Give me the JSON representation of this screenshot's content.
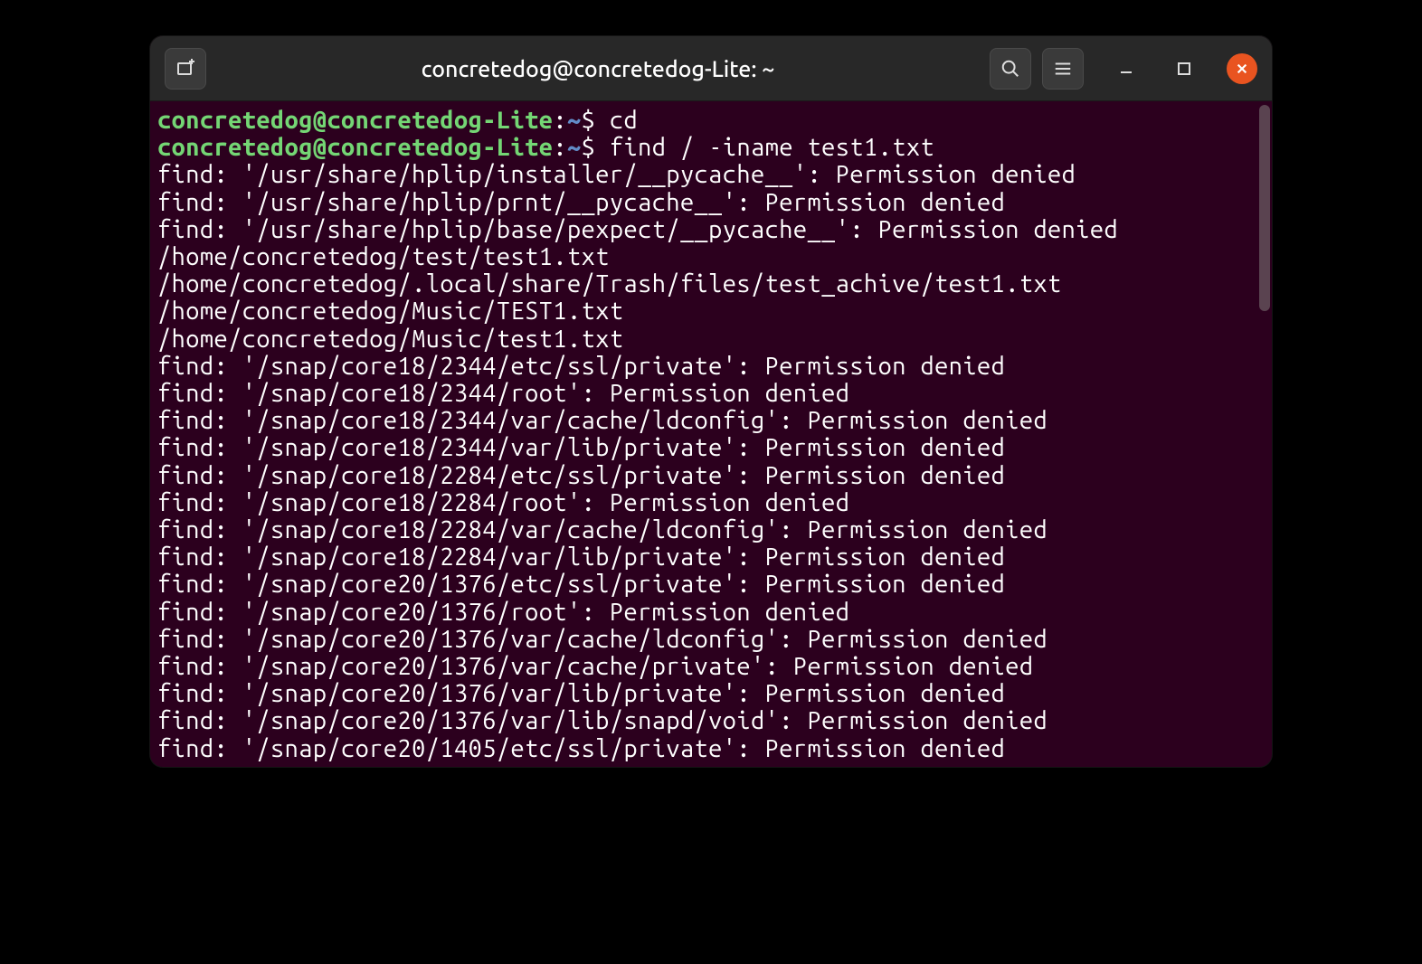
{
  "window": {
    "title": "concretedog@concretedog-Lite: ~"
  },
  "prompt": {
    "userhost": "concretedog@concretedog-Lite",
    "separator": ":",
    "path": "~",
    "symbol": "$"
  },
  "commands": [
    {
      "cmd": "cd"
    },
    {
      "cmd": "find / -iname test1.txt"
    }
  ],
  "output": [
    "find: '/usr/share/hplip/installer/__pycache__': Permission denied",
    "find: '/usr/share/hplip/prnt/__pycache__': Permission denied",
    "find: '/usr/share/hplip/base/pexpect/__pycache__': Permission denied",
    "/home/concretedog/test/test1.txt",
    "/home/concretedog/.local/share/Trash/files/test_achive/test1.txt",
    "/home/concretedog/Music/TEST1.txt",
    "/home/concretedog/Music/test1.txt",
    "find: '/snap/core18/2344/etc/ssl/private': Permission denied",
    "find: '/snap/core18/2344/root': Permission denied",
    "find: '/snap/core18/2344/var/cache/ldconfig': Permission denied",
    "find: '/snap/core18/2344/var/lib/private': Permission denied",
    "find: '/snap/core18/2284/etc/ssl/private': Permission denied",
    "find: '/snap/core18/2284/root': Permission denied",
    "find: '/snap/core18/2284/var/cache/ldconfig': Permission denied",
    "find: '/snap/core18/2284/var/lib/private': Permission denied",
    "find: '/snap/core20/1376/etc/ssl/private': Permission denied",
    "find: '/snap/core20/1376/root': Permission denied",
    "find: '/snap/core20/1376/var/cache/ldconfig': Permission denied",
    "find: '/snap/core20/1376/var/cache/private': Permission denied",
    "find: '/snap/core20/1376/var/lib/private': Permission denied",
    "find: '/snap/core20/1376/var/lib/snapd/void': Permission denied",
    "find: '/snap/core20/1405/etc/ssl/private': Permission denied"
  ]
}
